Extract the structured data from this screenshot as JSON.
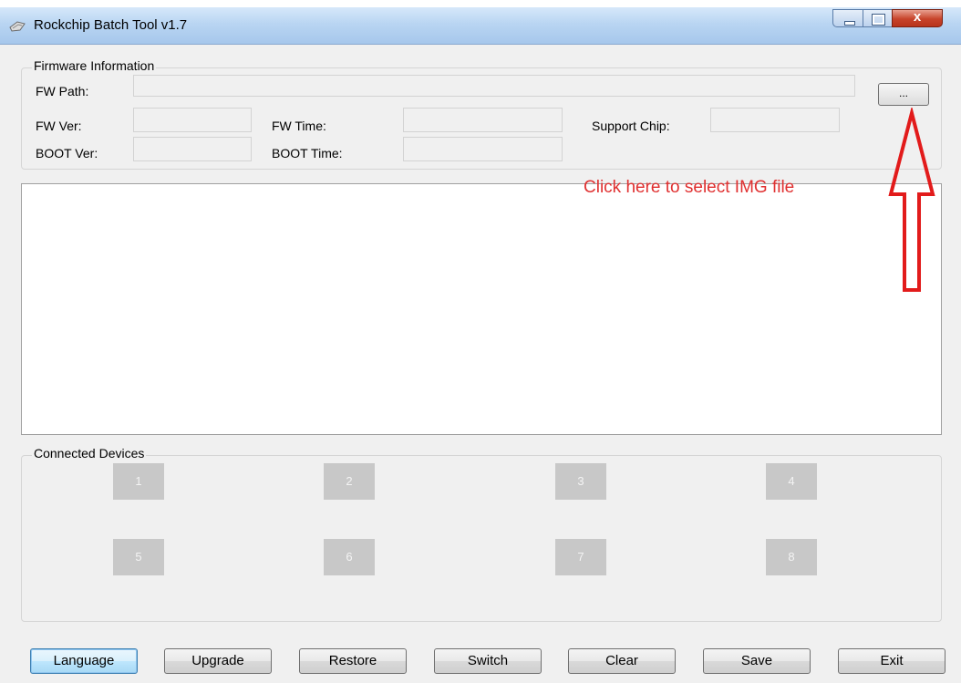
{
  "window": {
    "title": "Rockchip Batch Tool v1.7",
    "close_glyph": "x"
  },
  "firmware": {
    "legend": "Firmware Information",
    "fw_path_label": "FW Path:",
    "fw_ver_label": "FW Ver:",
    "fw_time_label": "FW Time:",
    "support_chip_label": "Support Chip:",
    "boot_ver_label": "BOOT Ver:",
    "boot_time_label": "BOOT Time:",
    "browse_label": "...",
    "fw_path_value": "",
    "fw_ver_value": "",
    "fw_time_value": "",
    "support_chip_value": "",
    "boot_ver_value": "",
    "boot_time_value": ""
  },
  "annotation": {
    "text": "Click here to select IMG file",
    "color": "#e03030"
  },
  "devices": {
    "legend": "Connected Devices",
    "slots": [
      "1",
      "2",
      "3",
      "4",
      "5",
      "6",
      "7",
      "8"
    ]
  },
  "buttons": {
    "language": "Language",
    "upgrade": "Upgrade",
    "restore": "Restore",
    "switch": "Switch",
    "clear": "Clear",
    "save": "Save",
    "exit": "Exit"
  },
  "icons": {
    "app": "app-icon",
    "arrow": "up-arrow-icon",
    "minimize": "minimize-icon",
    "maximize": "maximize-icon",
    "close": "close-icon"
  }
}
